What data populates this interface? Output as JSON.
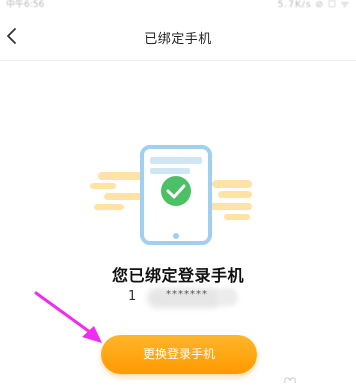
{
  "status_bar": {
    "time": "中午6:56",
    "indicators": "5.7K/s ⊘ ☐ ᯤ"
  },
  "nav": {
    "title": "已绑定手机",
    "back_icon": "chevron-left-icon"
  },
  "main": {
    "headline": "您已绑定登录手机",
    "phone_first_digit": "1",
    "phone_masked": "*******",
    "change_button_label": "更换登录手机"
  },
  "colors": {
    "accent": "#FF9F00",
    "check_green": "#4CC064",
    "phone_blue": "#9FD0F2",
    "annotation_arrow": "#EE2DF0"
  }
}
